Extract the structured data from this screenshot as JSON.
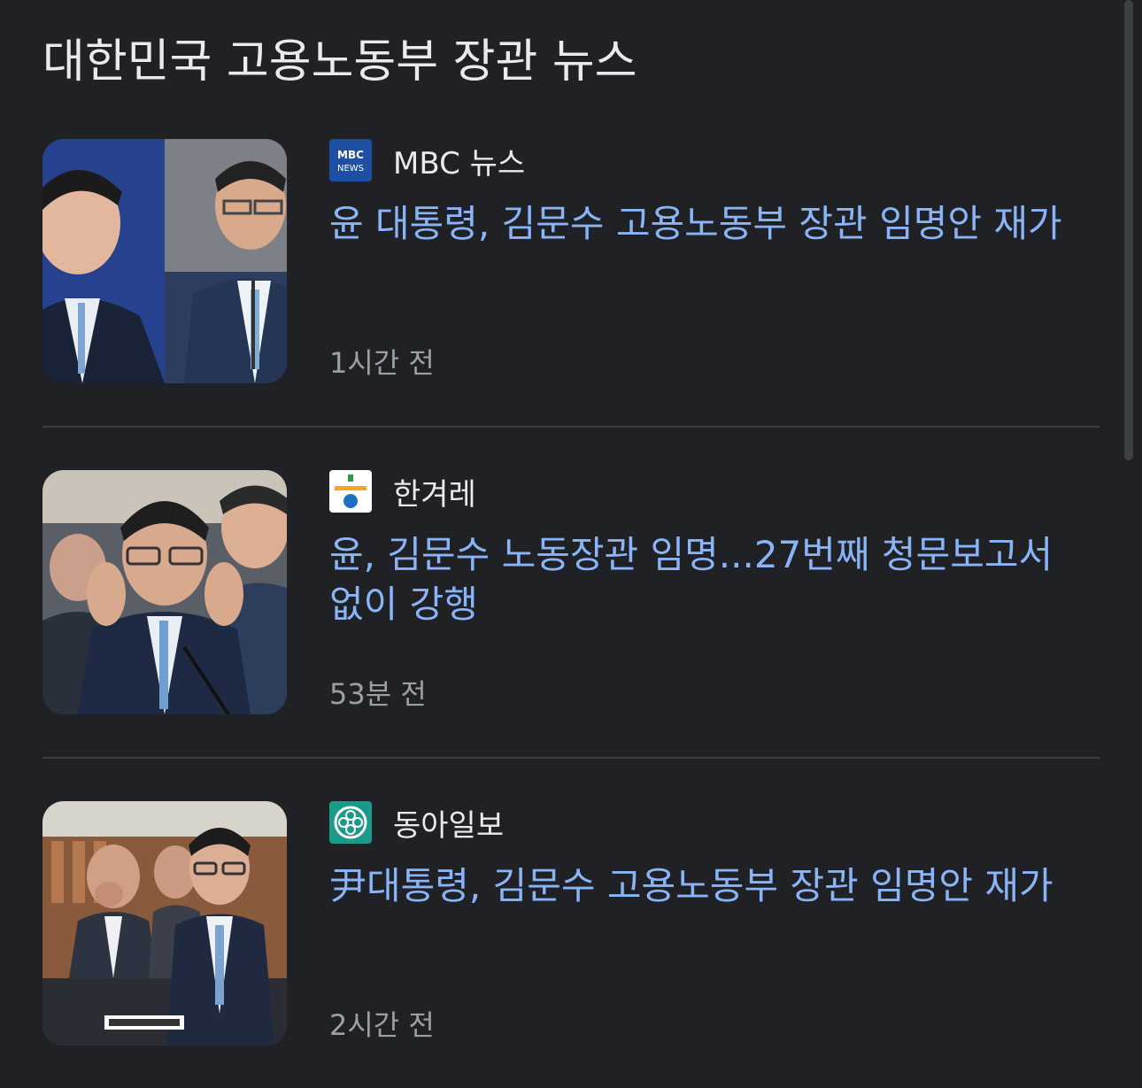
{
  "page": {
    "title": "대한민국 고용노동부 장관 뉴스"
  },
  "news": [
    {
      "source": "MBC 뉴스",
      "source_logo_icon": "mbc-news-logo",
      "headline": "윤 대통령, 김문수 고용노동부 장관 임명안 재가",
      "time": "1시간 전",
      "thumbnail": "two-men-split-portrait"
    },
    {
      "source": "한겨레",
      "source_logo_icon": "hankyoreh-logo",
      "headline": "윤, 김문수 노동장관 임명...27번째 청문보고서 없이 강행",
      "time": "53분 전",
      "thumbnail": "hearing-man-hands-raised"
    },
    {
      "source": "동아일보",
      "source_logo_icon": "donga-ilbo-logo",
      "headline": "尹대통령, 김문수 고용노동부 장관 임명안 재가",
      "time": "2시간 전",
      "thumbnail": "hearing-room-standing-man"
    }
  ],
  "colors": {
    "background": "#202124",
    "headline": "#8ab4f8",
    "text": "#e8eaed",
    "muted": "#9aa0a6",
    "divider": "#3c4043"
  }
}
